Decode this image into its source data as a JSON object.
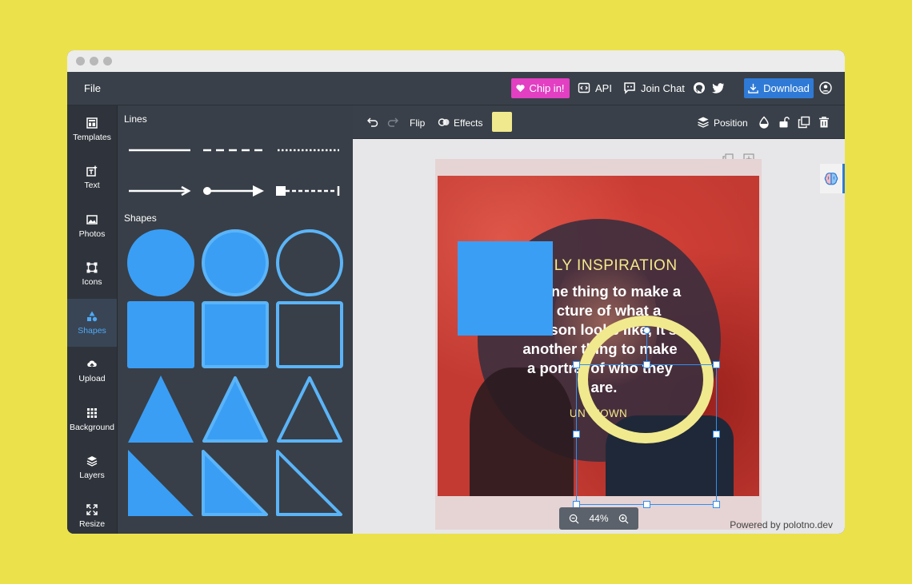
{
  "topbar": {
    "file_label": "File",
    "chip_label": "Chip in!",
    "api_label": "API",
    "join_chat_label": "Join Chat",
    "download_label": "Download"
  },
  "sidebar": {
    "items": [
      {
        "label": "Templates",
        "icon": "templates-icon"
      },
      {
        "label": "Text",
        "icon": "text-icon"
      },
      {
        "label": "Photos",
        "icon": "photos-icon"
      },
      {
        "label": "Icons",
        "icon": "icons-icon"
      },
      {
        "label": "Shapes",
        "icon": "shapes-icon",
        "active": true
      },
      {
        "label": "Upload",
        "icon": "upload-icon"
      },
      {
        "label": "Background",
        "icon": "background-icon"
      },
      {
        "label": "Layers",
        "icon": "layers-icon"
      },
      {
        "label": "Resize",
        "icon": "resize-icon"
      }
    ]
  },
  "panel": {
    "lines_heading": "Lines",
    "shapes_heading": "Shapes"
  },
  "toolbar": {
    "flip_label": "Flip",
    "effects_label": "Effects",
    "position_label": "Position",
    "fill_color": "#f1e98d"
  },
  "canvas": {
    "quote_title": "ILY INSPIRATION",
    "quote_lines": [
      "ne thing to make a",
      "cture of what a",
      "erson looks like, it's",
      "another thing to make",
      "a portra  of who they",
      "are."
    ],
    "quote_author": "UN  NOWN"
  },
  "zoom": {
    "level": "44%"
  },
  "footer": {
    "powered_by": "Powered by polotno.dev"
  },
  "colors": {
    "accent": "#2f7ad6",
    "chip": "#e23fc2",
    "shape_fill": "#3a9ef5",
    "shape_light": "#5bb4f8"
  }
}
